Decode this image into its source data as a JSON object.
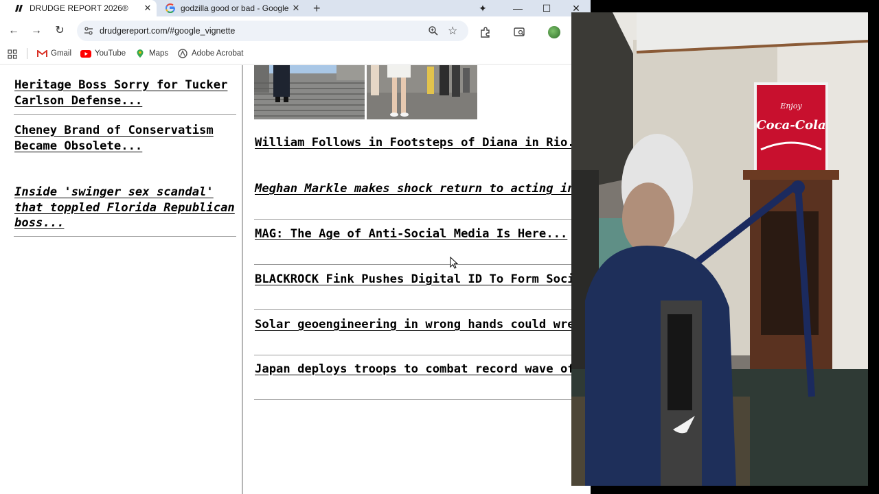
{
  "tabs": [
    {
      "title": "DRUDGE REPORT 2026®",
      "active": true
    },
    {
      "title": "godzilla good or bad - Google",
      "active": false
    }
  ],
  "address_bar": {
    "url": "drudgereport.com/#google_vignette"
  },
  "bookmarks": [
    {
      "label": "Gmail",
      "icon": "gmail-icon"
    },
    {
      "label": "YouTube",
      "icon": "youtube-icon"
    },
    {
      "label": "Maps",
      "icon": "maps-icon"
    },
    {
      "label": "Adobe Acrobat",
      "icon": "acrobat-icon"
    }
  ],
  "left_column": {
    "headlines": [
      {
        "text": "Heritage Boss Sorry for Tucker Carlson Defense...",
        "italic": false
      },
      {
        "text": "Cheney Brand of Conservatism Became Obsolete...",
        "italic": false
      },
      {
        "text": "Inside 'swinger sex scandal' that toppled Florida Republican boss...",
        "italic": true
      }
    ]
  },
  "right_column": {
    "headlines": [
      {
        "text": "William Follows in Footsteps of Diana in Rio...",
        "italic": false
      },
      {
        "text": "Meghan Markle makes shock return to acting in new Hollywood movie...",
        "italic": true
      },
      {
        "text": "MAG: The Age of Anti-Social Media Is Here...",
        "italic": false
      },
      {
        "text": "BLACKROCK Fink Pushes Digital ID To Form Social Credit Score...",
        "italic": false
      },
      {
        "text": "Solar geoengineering in wrong hands could wreak climate havoc, scientists warn...",
        "italic": false
      },
      {
        "text": "Japan deploys troops to combat record wave of deadly bear attacks...",
        "italic": false
      }
    ]
  },
  "sign_text": {
    "line1": "Enjoy",
    "line2": "Coca-Cola"
  },
  "colors": {
    "tabstrip": "#dbe3ef",
    "omnibox": "#eef2f8",
    "link": "#000000",
    "sign_red": "#c8102e"
  }
}
